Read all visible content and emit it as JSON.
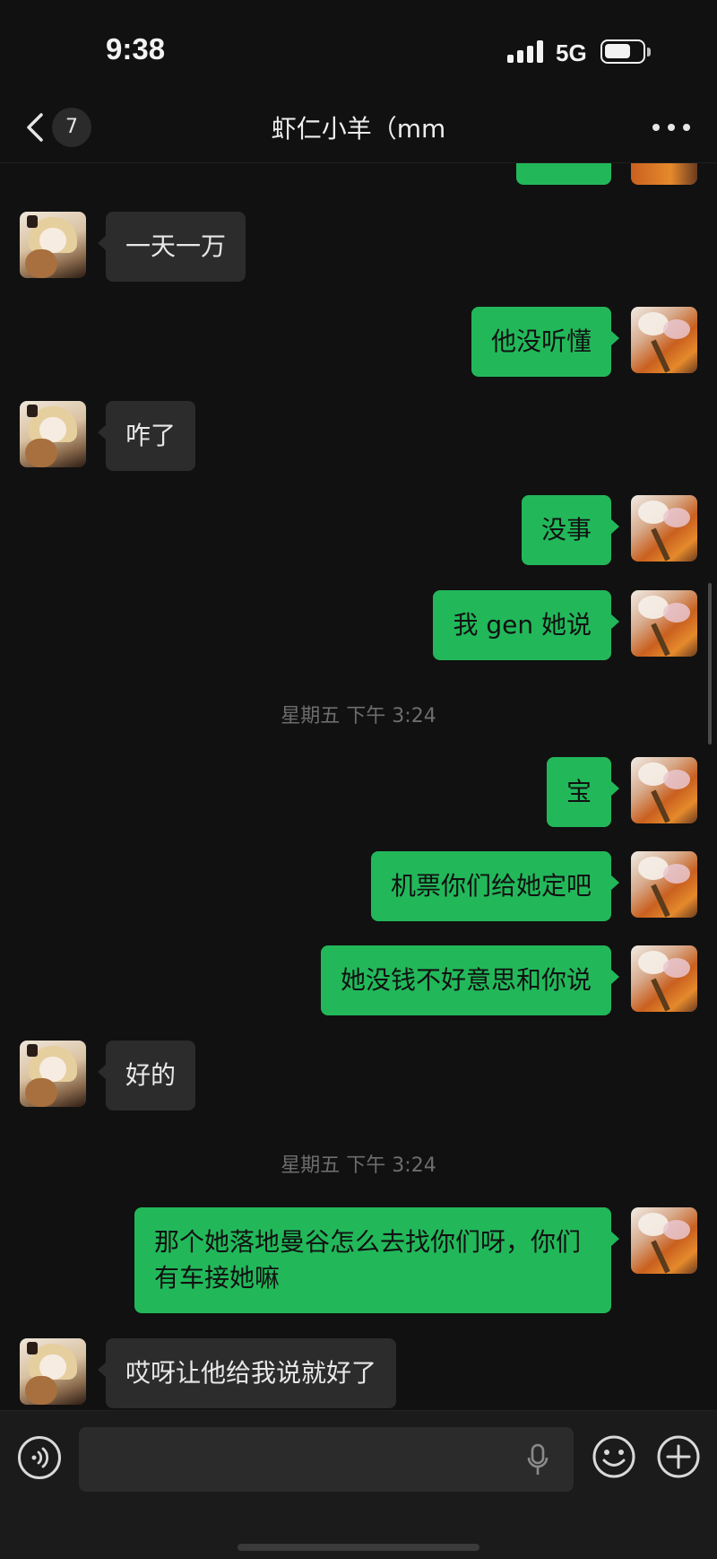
{
  "status_bar": {
    "time": "9:38",
    "network": "5G"
  },
  "header": {
    "unread_count": "7",
    "title": "虾仁小羊（mm"
  },
  "messages": [
    {
      "from": "them",
      "text": "一天一万"
    },
    {
      "from": "me",
      "text": "他没听懂"
    },
    {
      "from": "them",
      "text": "咋了"
    },
    {
      "from": "me",
      "text": "没事"
    },
    {
      "from": "me",
      "text": "我 gen 她说"
    },
    {
      "timestamp": "星期五 下午 3:24"
    },
    {
      "from": "me",
      "text": "宝"
    },
    {
      "from": "me",
      "text": "机票你们给她定吧"
    },
    {
      "from": "me",
      "text": "她没钱不好意思和你说"
    },
    {
      "from": "them",
      "text": "好的"
    },
    {
      "timestamp": "星期五 下午 3:24"
    },
    {
      "from": "me",
      "text": "那个她落地曼谷怎么去找你们呀，你们有车接她嘛"
    },
    {
      "from": "them",
      "text": "哎呀让他给我说就好了"
    }
  ],
  "input": {
    "placeholder": "",
    "value": ""
  },
  "colors": {
    "background": "#111111",
    "bubble_out": "#22b85a",
    "bubble_in": "#2c2c2c"
  },
  "icons": [
    "back-chevron-icon",
    "more-icon",
    "voice-icon",
    "mic-icon",
    "emoji-icon",
    "plus-icon"
  ]
}
